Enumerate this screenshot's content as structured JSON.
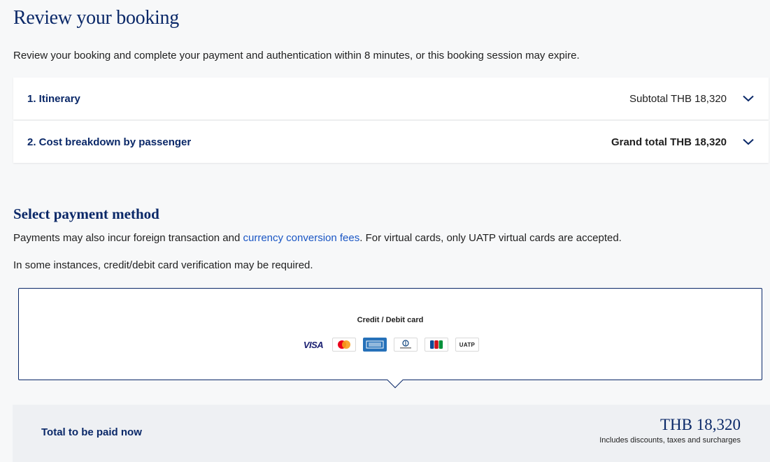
{
  "page": {
    "title": "Review your booking",
    "intro": "Review your booking and complete your payment and authentication within 8 minutes, or this booking session may expire."
  },
  "accordion": [
    {
      "label": "1. Itinerary",
      "total": "Subtotal THB 18,320",
      "icon": "chevron-down-icon"
    },
    {
      "label": "2. Cost breakdown by passenger",
      "total": "Grand total THB 18,320",
      "icon": "chevron-down-icon"
    }
  ],
  "payment": {
    "title": "Select payment method",
    "note_prefix": "Payments may also incur foreign transaction and ",
    "note_link": "currency conversion fees",
    "note_suffix": ". For virtual cards, only UATP virtual cards are accepted.",
    "verify_note": "In some instances, credit/debit card verification may be required.",
    "card_option": {
      "title": "Credit / Debit card",
      "logos": [
        "VISA",
        "mastercard",
        "amex",
        "Diners Club",
        "JCB",
        "UATP"
      ]
    }
  },
  "total": {
    "label": "Total to be paid now",
    "amount": "THB 18,320",
    "sub": "Includes discounts, taxes and surcharges"
  },
  "colors": {
    "brand": "#0a2868",
    "link": "#1a56c4",
    "background": "#f7f8f9"
  }
}
